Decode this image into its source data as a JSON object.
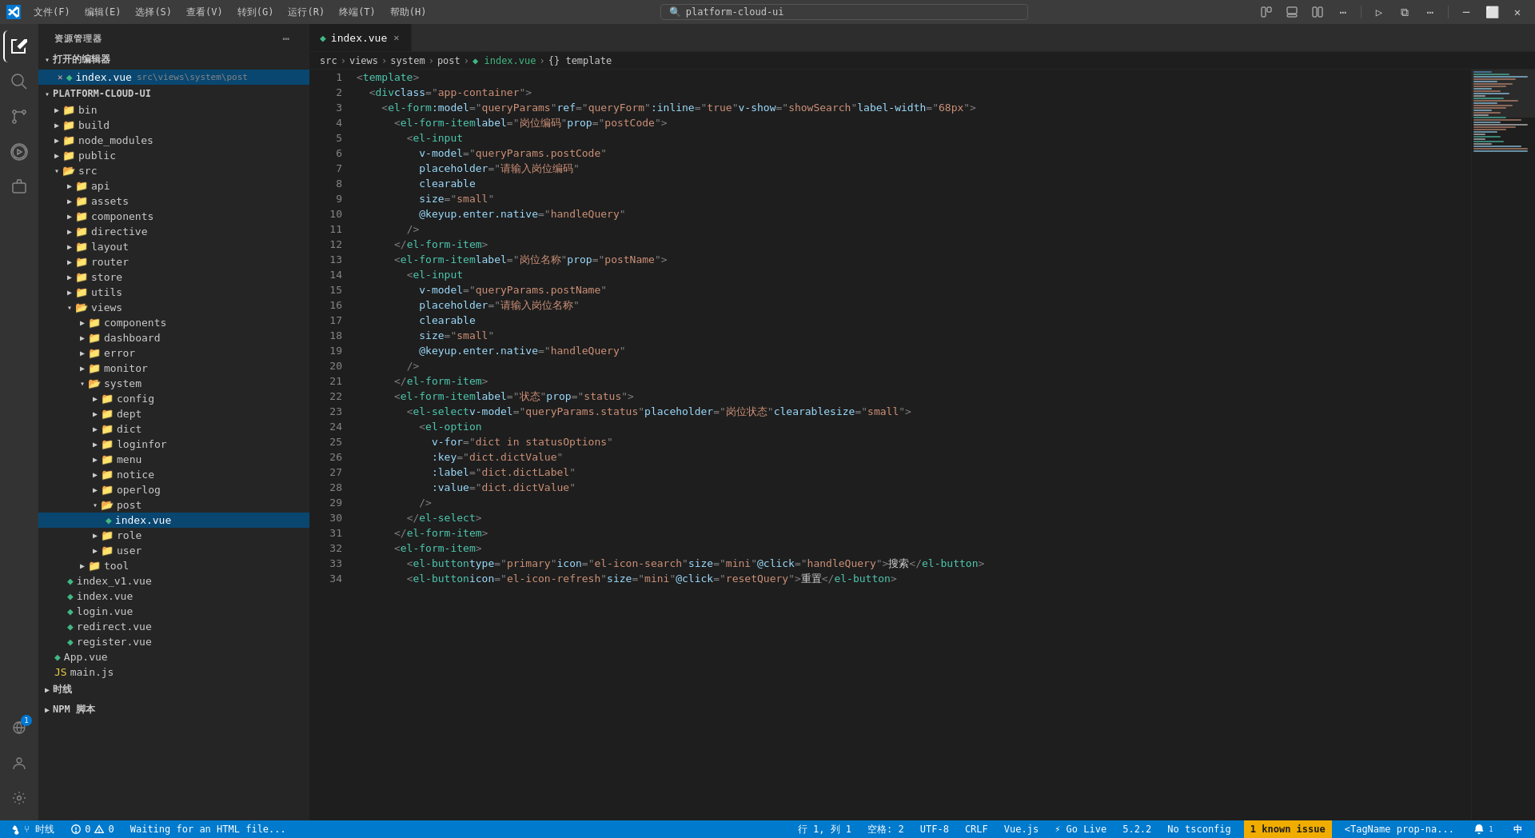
{
  "titlebar": {
    "menu_items": [
      "文件(F)",
      "编辑(E)",
      "选择(S)",
      "查看(V)",
      "转到(G)",
      "运行(R)",
      "终端(T)",
      "帮助(H)"
    ],
    "search_placeholder": "platform-cloud-ui",
    "window_controls": [
      "minimize",
      "maximize",
      "restore",
      "close"
    ]
  },
  "activity_bar": {
    "items": [
      {
        "id": "explorer",
        "icon": "📁",
        "active": true
      },
      {
        "id": "search",
        "icon": "🔍"
      },
      {
        "id": "source-control",
        "icon": "⑂"
      },
      {
        "id": "run",
        "icon": "▷"
      },
      {
        "id": "extensions",
        "icon": "⊞"
      }
    ],
    "bottom": [
      {
        "id": "remote",
        "icon": "⌥",
        "badge": "1"
      },
      {
        "id": "account",
        "icon": "👤"
      },
      {
        "id": "settings",
        "icon": "⚙"
      }
    ]
  },
  "sidebar": {
    "title": "资源管理器",
    "sections": {
      "open_editors": {
        "label": "打开的编辑器",
        "files": [
          {
            "name": "index.vue",
            "path": "src\\views\\system\\post",
            "active": true,
            "modified": true,
            "color": "#42b883"
          }
        ]
      },
      "project": {
        "label": "PLATFORM-CLOUD-UI",
        "tree": [
          {
            "name": "bin",
            "type": "folder",
            "level": 1
          },
          {
            "name": "build",
            "type": "folder",
            "level": 1
          },
          {
            "name": "node_modules",
            "type": "folder",
            "level": 1
          },
          {
            "name": "public",
            "type": "folder",
            "level": 1
          },
          {
            "name": "src",
            "type": "folder",
            "level": 1,
            "open": true
          },
          {
            "name": "api",
            "type": "folder",
            "level": 2
          },
          {
            "name": "assets",
            "type": "folder",
            "level": 2
          },
          {
            "name": "components",
            "type": "folder",
            "level": 2
          },
          {
            "name": "directive",
            "type": "folder",
            "level": 2
          },
          {
            "name": "layout",
            "type": "folder",
            "level": 2
          },
          {
            "name": "router",
            "type": "folder",
            "level": 2
          },
          {
            "name": "store",
            "type": "folder",
            "level": 2
          },
          {
            "name": "utils",
            "type": "folder",
            "level": 2
          },
          {
            "name": "views",
            "type": "folder",
            "level": 2,
            "open": true
          },
          {
            "name": "components",
            "type": "folder",
            "level": 3
          },
          {
            "name": "dashboard",
            "type": "folder",
            "level": 3
          },
          {
            "name": "error",
            "type": "folder",
            "level": 3
          },
          {
            "name": "monitor",
            "type": "folder",
            "level": 3
          },
          {
            "name": "system",
            "type": "folder",
            "level": 3,
            "open": true
          },
          {
            "name": "config",
            "type": "folder",
            "level": 4
          },
          {
            "name": "dept",
            "type": "folder",
            "level": 4
          },
          {
            "name": "dict",
            "type": "folder",
            "level": 4
          },
          {
            "name": "loginfor",
            "type": "folder",
            "level": 4
          },
          {
            "name": "menu",
            "type": "folder",
            "level": 4
          },
          {
            "name": "notice",
            "type": "folder",
            "level": 4
          },
          {
            "name": "operlog",
            "type": "folder",
            "level": 4
          },
          {
            "name": "post",
            "type": "folder",
            "level": 4,
            "open": true
          },
          {
            "name": "index.vue",
            "type": "file",
            "level": 5,
            "active": true,
            "color": "#42b883"
          },
          {
            "name": "role",
            "type": "folder",
            "level": 4
          },
          {
            "name": "user",
            "type": "folder",
            "level": 4
          },
          {
            "name": "tool",
            "type": "folder",
            "level": 3
          },
          {
            "name": "index_v1.vue",
            "type": "file",
            "level": 2,
            "color": "#42b883"
          },
          {
            "name": "index.vue",
            "type": "file",
            "level": 2,
            "color": "#42b883"
          },
          {
            "name": "login.vue",
            "type": "file",
            "level": 2,
            "color": "#42b883"
          },
          {
            "name": "redirect.vue",
            "type": "file",
            "level": 2,
            "color": "#42b883"
          },
          {
            "name": "register.vue",
            "type": "file",
            "level": 2,
            "color": "#42b883"
          },
          {
            "name": "App.vue",
            "type": "file",
            "level": 1,
            "color": "#42b883"
          },
          {
            "name": "main.js",
            "type": "file",
            "level": 1,
            "color": "#f0d040"
          }
        ]
      },
      "outline": {
        "label": "时线"
      },
      "npm_scripts": {
        "label": "NPM 脚本"
      }
    }
  },
  "tabs": [
    {
      "name": "index.vue",
      "active": true,
      "modified": false,
      "path": "src/views/system/post/index.vue"
    }
  ],
  "breadcrumb": {
    "parts": [
      "src",
      "views",
      "system",
      "post",
      "index.vue",
      "{} template"
    ]
  },
  "editor": {
    "lines": [
      {
        "num": 1,
        "code": "<template>",
        "tokens": [
          {
            "t": "punctuation",
            "v": "<"
          },
          {
            "t": "tag",
            "v": "template"
          },
          {
            "t": "punctuation",
            "v": ">"
          }
        ]
      },
      {
        "num": 2,
        "code": "  <div class=\"app-container\">",
        "tokens": [
          {
            "t": "punctuation",
            "v": "  <"
          },
          {
            "t": "tag",
            "v": "div"
          },
          {
            "t": "space",
            "v": " "
          },
          {
            "t": "attr-name",
            "v": "class"
          },
          {
            "t": "punctuation",
            "v": "=\""
          },
          {
            "t": "attr-value",
            "v": "app-container"
          },
          {
            "t": "punctuation",
            "v": "\">"
          }
        ]
      },
      {
        "num": 3,
        "code": "    <el-form :model=\"queryParams\" ref=\"queryForm\" :inline=\"true\" v-show=\"showSearch\" label-width=\"68px\">"
      },
      {
        "num": 4,
        "code": "      <el-form-item label=\"岗位编码\" prop=\"postCode\">"
      },
      {
        "num": 5,
        "code": "        <el-input"
      },
      {
        "num": 6,
        "code": "          v-model=\"queryParams.postCode\""
      },
      {
        "num": 7,
        "code": "          placeholder=\"请输入岗位编码\""
      },
      {
        "num": 8,
        "code": "          clearable"
      },
      {
        "num": 9,
        "code": "          size=\"small\""
      },
      {
        "num": 10,
        "code": "          @keyup.enter.native=\"handleQuery\""
      },
      {
        "num": 11,
        "code": "        />"
      },
      {
        "num": 12,
        "code": "      </el-form-item>"
      },
      {
        "num": 13,
        "code": "      <el-form-item label=\"岗位名称\" prop=\"postName\">"
      },
      {
        "num": 14,
        "code": "        <el-input"
      },
      {
        "num": 15,
        "code": "          v-model=\"queryParams.postName\""
      },
      {
        "num": 16,
        "code": "          placeholder=\"请输入岗位名称\""
      },
      {
        "num": 17,
        "code": "          clearable"
      },
      {
        "num": 18,
        "code": "          size=\"small\""
      },
      {
        "num": 19,
        "code": "          @keyup.enter.native=\"handleQuery\""
      },
      {
        "num": 20,
        "code": "        />"
      },
      {
        "num": 21,
        "code": "      </el-form-item>"
      },
      {
        "num": 22,
        "code": "      <el-form-item label=\"状态\" prop=\"status\">"
      },
      {
        "num": 23,
        "code": "        <el-select v-model=\"queryParams.status\" placeholder=\"岗位状态\" clearable size=\"small\">"
      },
      {
        "num": 24,
        "code": "          <el-option"
      },
      {
        "num": 25,
        "code": "            v-for=\"dict in statusOptions\""
      },
      {
        "num": 26,
        "code": "            :key=\"dict.dictValue\""
      },
      {
        "num": 27,
        "code": "            :label=\"dict.dictLabel\""
      },
      {
        "num": 28,
        "code": "            :value=\"dict.dictValue\""
      },
      {
        "num": 29,
        "code": "          />"
      },
      {
        "num": 30,
        "code": "        </el-select>"
      },
      {
        "num": 31,
        "code": "      </el-form-item>"
      },
      {
        "num": 32,
        "code": "      <el-form-item>"
      },
      {
        "num": 33,
        "code": "        <el-button type=\"primary\" icon=\"el-icon-search\" size=\"mini\" @click=\"handleQuery\">搜索</el-button>"
      },
      {
        "num": 34,
        "code": "        <el-button icon=\"el-icon-refresh\" size=\"mini\" @click=\"resetQuery\">重置</el-button>"
      }
    ]
  },
  "status_bar": {
    "left": {
      "git_branch": "⑂ 时线",
      "errors": "⓪ 0",
      "warnings": "⚠ 0",
      "info": "Waiting for an HTML file..."
    },
    "right": {
      "position": "行 1, 列 1",
      "spaces": "空格: 2",
      "encoding": "UTF-8",
      "line_ending": "CRLF",
      "language": "Vue.js",
      "go_live": "⚡ Go Live",
      "version": "5.2.2",
      "no_tsconfig": "No tsconfig",
      "known_issue": "1 known issue",
      "tag_name": "<TagName prop-na..."
    }
  }
}
